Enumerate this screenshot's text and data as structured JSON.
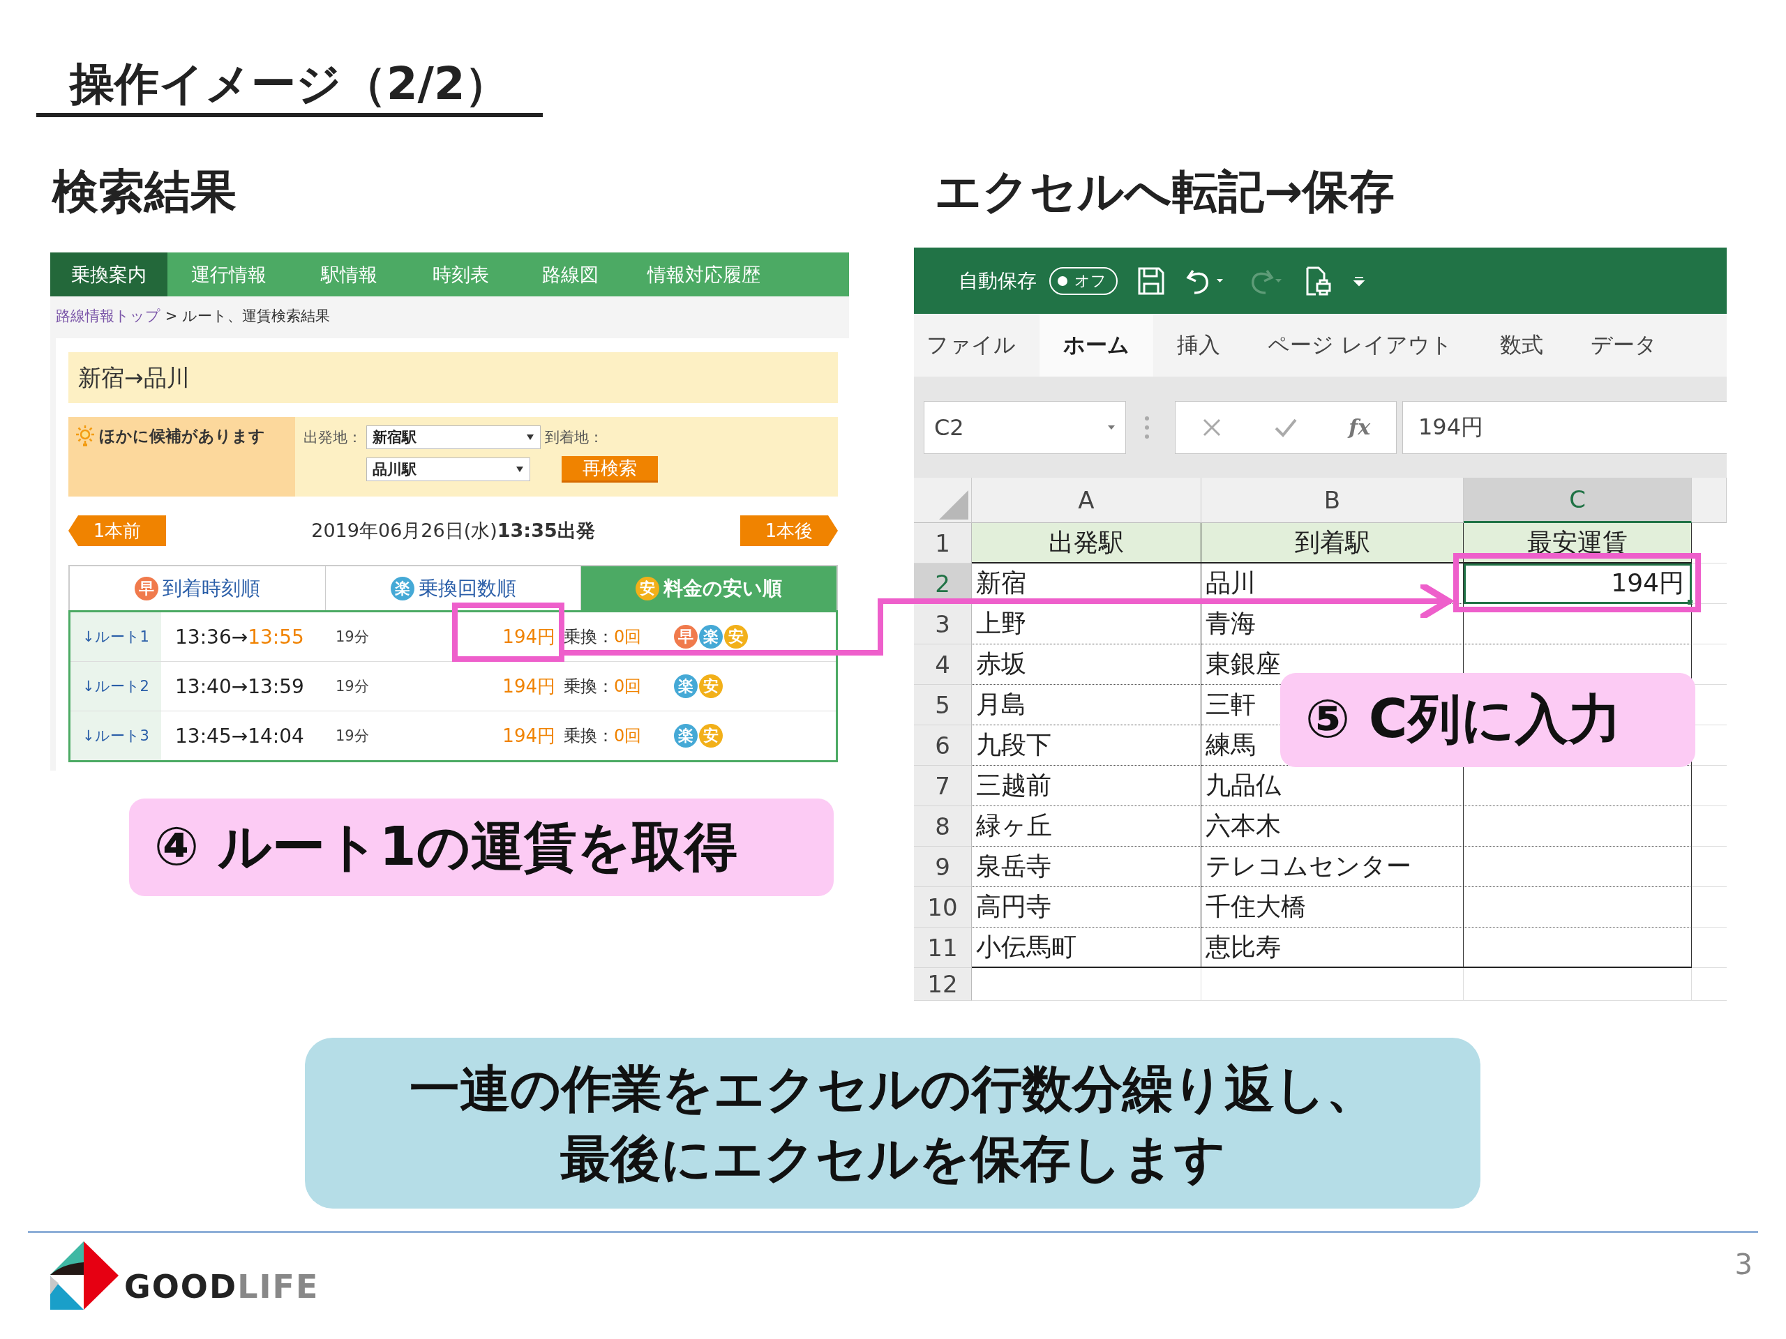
{
  "slide": {
    "title": "操作イメージ（2/2）",
    "page_number": "3",
    "logo_parts": [
      "GOOD",
      "LIFE"
    ]
  },
  "search_section": {
    "heading": "検索結果",
    "nav": [
      {
        "label": "乗換案内",
        "selected": true
      },
      {
        "label": "運行情報",
        "selected": false
      },
      {
        "label": "駅情報",
        "selected": false
      },
      {
        "label": "時刻表",
        "selected": false
      },
      {
        "label": "路線図",
        "selected": false
      },
      {
        "label": "情報対応履歴",
        "selected": false
      }
    ],
    "breadcrumb": {
      "link": "路線情報トップ",
      "current": " > ルート、運賃検索結果"
    },
    "route_title": "新宿→品川",
    "candidates": {
      "notice": "ほかに候補があります",
      "fields": [
        {
          "label": "出発地：",
          "value": "新宿駅"
        },
        {
          "label": "到着地：",
          "value": "品川駅"
        }
      ],
      "button": "再検索"
    },
    "prev_button": "1本前",
    "departure": "2019年06月26日(水)**13:35出発**",
    "next_button": "1本後",
    "sort_tabs": [
      {
        "badge": "早",
        "color": "#f07a4c",
        "label": "到着時刻順",
        "selected": false
      },
      {
        "badge": "楽",
        "color": "#45a9d6",
        "label": "乗換回数順",
        "selected": false
      },
      {
        "badge": "安",
        "color": "#f2b019",
        "label": "料金の安い順",
        "selected": true
      }
    ],
    "routes": [
      {
        "name": "↓ルート1",
        "depart": "13:36→",
        "arrive": "13:55",
        "arrive_highlight": true,
        "duration": "19分",
        "fare": "194円",
        "transfer_label": "乗換：",
        "transfers": "0回",
        "badges": [
          {
            "text": "早",
            "color": "#f07a4c"
          },
          {
            "text": "楽",
            "color": "#45a9d6"
          },
          {
            "text": "安",
            "color": "#f2b019"
          }
        ]
      },
      {
        "name": "↓ルート2",
        "depart": "13:40→",
        "arrive": "13:59",
        "arrive_highlight": false,
        "duration": "19分",
        "fare": "194円",
        "transfer_label": "乗換：",
        "transfers": "0回",
        "badges": [
          {
            "text": "楽",
            "color": "#45a9d6"
          },
          {
            "text": "安",
            "color": "#f2b019"
          }
        ]
      },
      {
        "name": "↓ルート3",
        "depart": "13:45→",
        "arrive": "14:04",
        "arrive_highlight": false,
        "duration": "19分",
        "fare": "194円",
        "transfer_label": "乗換：",
        "transfers": "0回",
        "badges": [
          {
            "text": "楽",
            "color": "#45a9d6"
          },
          {
            "text": "安",
            "color": "#f2b019"
          }
        ]
      }
    ],
    "callout": "④ ルート1の運賃を取得"
  },
  "excel_section": {
    "heading": "エクセルへ転記→保存",
    "autosave": {
      "label": "自動保存",
      "state_text": "オフ",
      "on": false
    },
    "ribbon_tabs": [
      {
        "label": "ファイル",
        "selected": false
      },
      {
        "label": "ホーム",
        "selected": true
      },
      {
        "label": "挿入",
        "selected": false
      },
      {
        "label": "ページ レイアウト",
        "selected": false
      },
      {
        "label": "数式",
        "selected": false
      },
      {
        "label": "データ",
        "selected": false
      }
    ],
    "name_box": "C2",
    "function_label": "fx",
    "formula": "194円",
    "columns": [
      {
        "label": "A",
        "selected": false
      },
      {
        "label": "B",
        "selected": false
      },
      {
        "label": "C",
        "selected": true
      }
    ],
    "rows": [
      {
        "number": "1",
        "kind": "header",
        "selected": false,
        "cells": [
          "出発駅",
          "到着駅",
          "最安運賃"
        ]
      },
      {
        "number": "2",
        "kind": "data",
        "selected": true,
        "cells": [
          "新宿",
          "品川",
          "194円"
        ]
      },
      {
        "number": "3",
        "kind": "data",
        "selected": false,
        "cells": [
          "上野",
          "青海"
        ]
      },
      {
        "number": "4",
        "kind": "data",
        "selected": false,
        "cells": [
          "赤坂",
          "東銀座"
        ]
      },
      {
        "number": "5",
        "kind": "data",
        "selected": false,
        "cells": [
          "月島",
          "三軒"
        ]
      },
      {
        "number": "6",
        "kind": "data",
        "selected": false,
        "cells": [
          "九段下",
          "練馬"
        ]
      },
      {
        "number": "7",
        "kind": "data",
        "selected": false,
        "cells": [
          "三越前",
          "九品仏"
        ]
      },
      {
        "number": "8",
        "kind": "data",
        "selected": false,
        "cells": [
          "緑ヶ丘",
          "六本木"
        ]
      },
      {
        "number": "9",
        "kind": "data",
        "selected": false,
        "cells": [
          "泉岳寺",
          "テレコムセンター"
        ]
      },
      {
        "number": "10",
        "kind": "data",
        "selected": false,
        "cells": [
          "高円寺",
          "千住大橋"
        ]
      },
      {
        "number": "11",
        "kind": "data",
        "selected": false,
        "cells": [
          "小伝馬町",
          "恵比寿"
        ]
      },
      {
        "number": "12",
        "kind": "data",
        "selected": false
      }
    ],
    "callout": "⑤ C列に入力"
  },
  "summary": [
    "一連の作業をエクセルの行数分繰り返し、",
    "最後にエクセルを保存します"
  ]
}
